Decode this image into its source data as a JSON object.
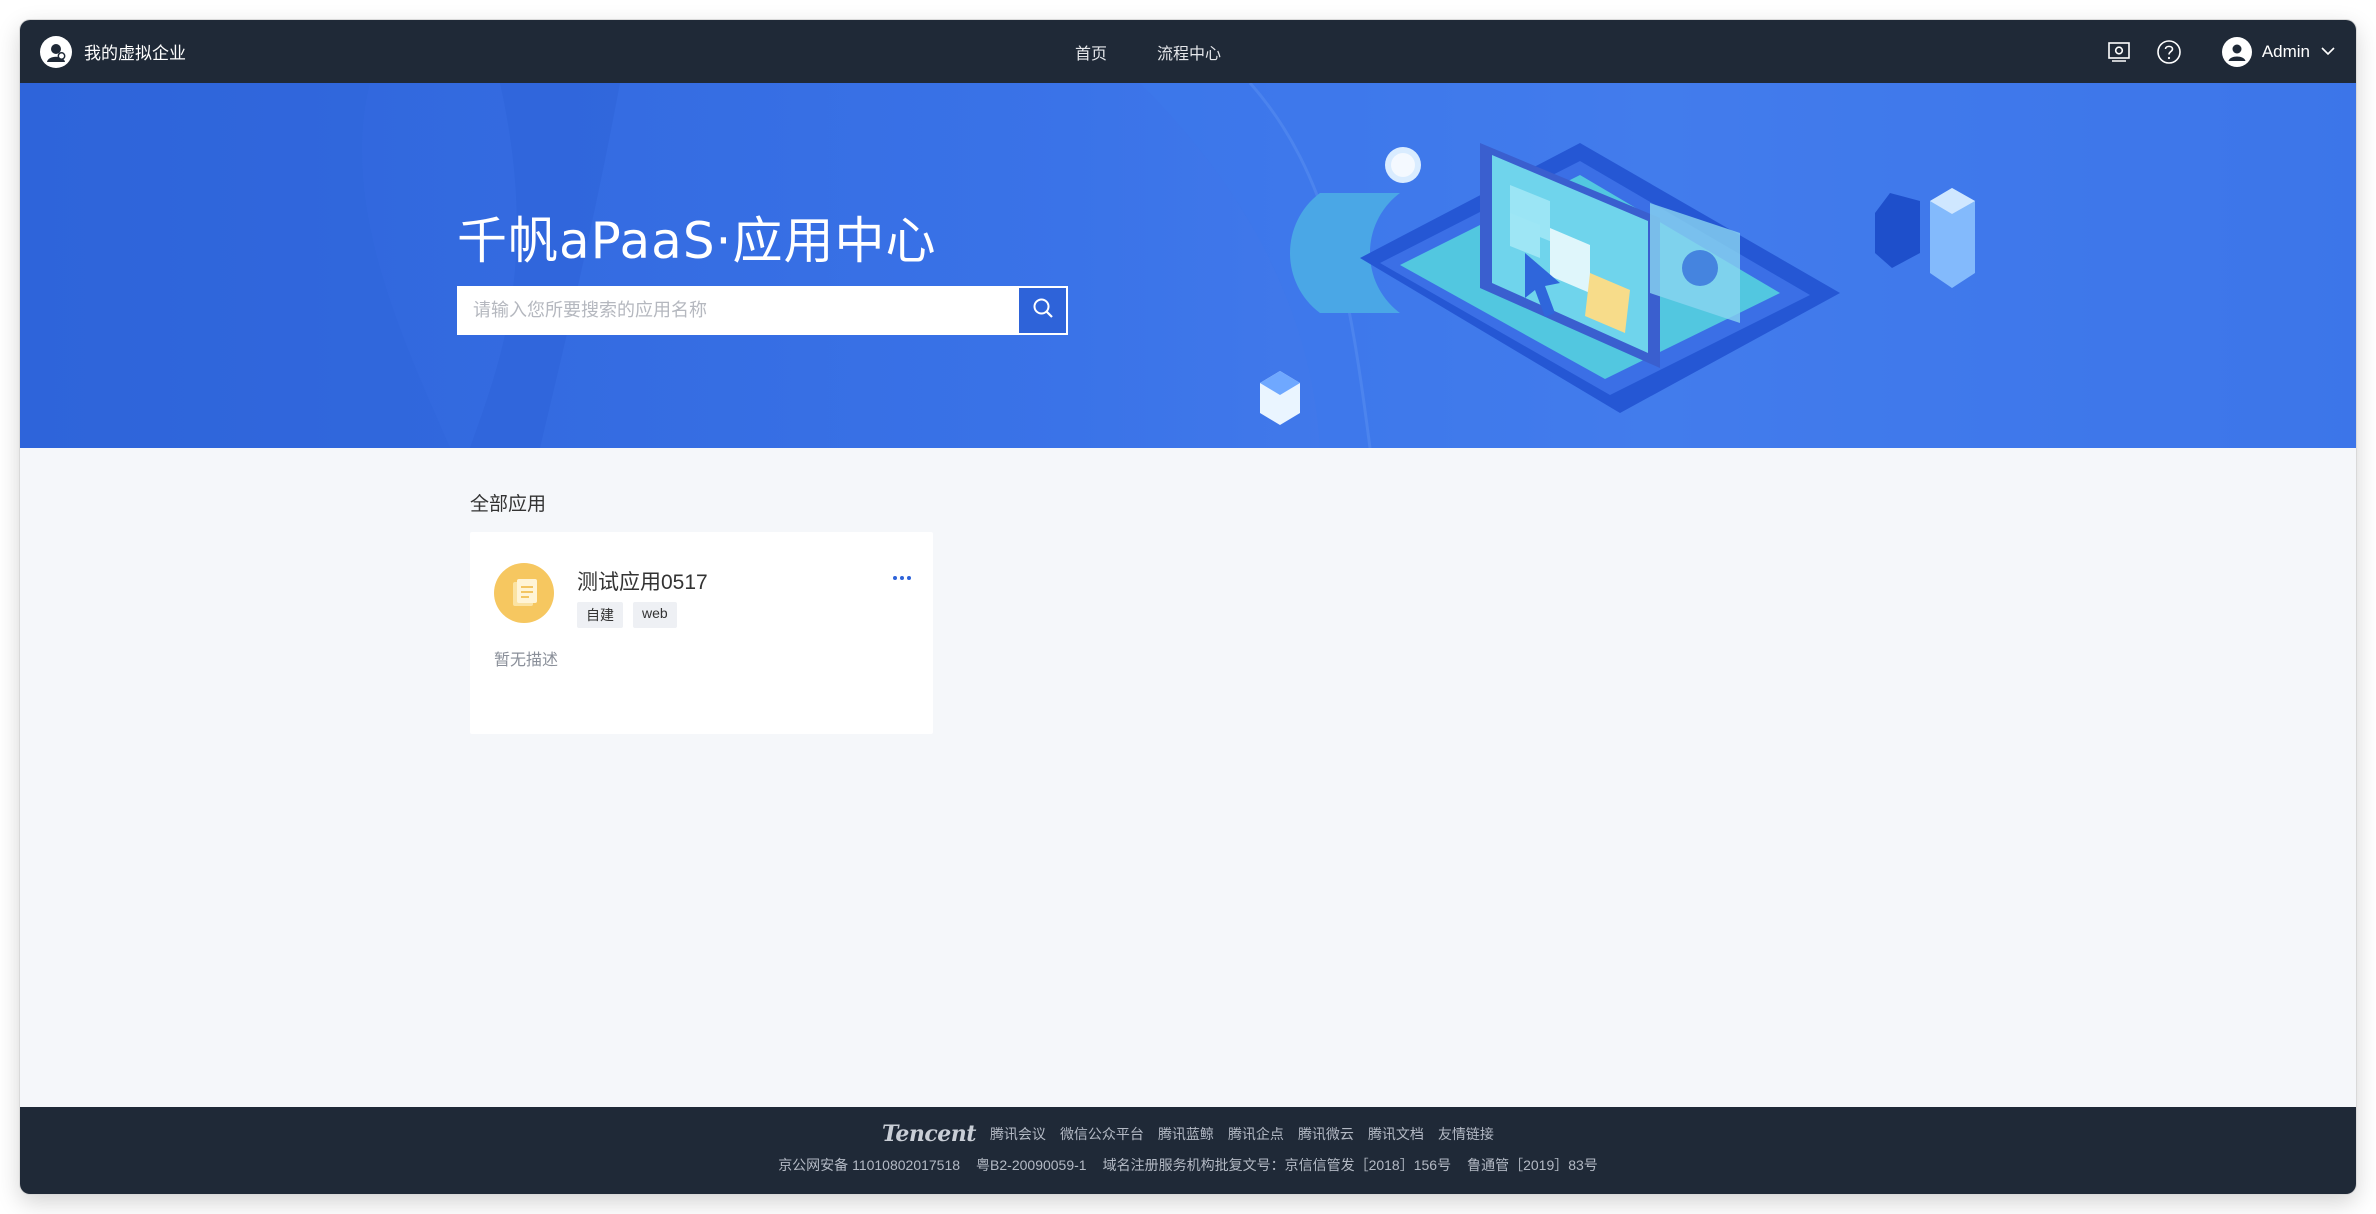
{
  "header": {
    "brand_name": "我的虚拟企业",
    "nav": [
      {
        "label": "首页"
      },
      {
        "label": "流程中心"
      }
    ],
    "user_name": "Admin"
  },
  "banner": {
    "title": "千帆aPaaS·应用中心",
    "search_placeholder": "请输入您所要搜索的应用名称"
  },
  "main": {
    "section_title": "全部应用",
    "apps": [
      {
        "name": "测试应用0517",
        "tags": [
          "自建",
          "web"
        ],
        "description": "暂无描述"
      }
    ]
  },
  "footer": {
    "logo_text": "Tencent",
    "links": [
      "腾讯会议",
      "微信公众平台",
      "腾讯蓝鲸",
      "腾讯企点",
      "腾讯微云",
      "腾讯文档",
      "友情链接"
    ],
    "legal": [
      "京公网安备 11010802017518",
      "粤B2-20090059-1",
      "域名注册服务机构批复文号：京信信管发［2018］156号",
      "鲁通管［2019］83号"
    ]
  },
  "colors": {
    "header_bg": "#1f2937",
    "banner_blue": "#3a73e8",
    "accent": "#2e63d9",
    "app_icon": "#f6c760"
  }
}
